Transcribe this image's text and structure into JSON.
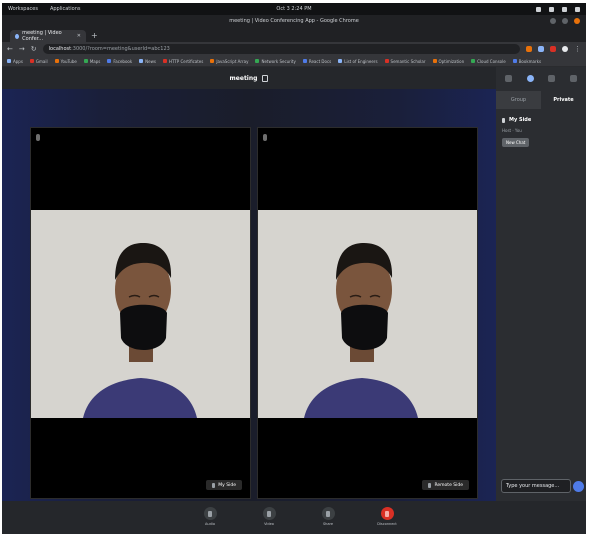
{
  "os_bar": {
    "activities": "Workspaces",
    "applications": "Applications",
    "clock": "Oct 3  2:24 PM",
    "tray_icons": [
      "network-icon",
      "volume-icon",
      "battery-icon",
      "power-icon"
    ]
  },
  "window": {
    "title": "meeting | Video Conferencing App - Google Chrome"
  },
  "browser": {
    "tab_label": "meeting | Video Confer...",
    "address_host": "localhost",
    "address_path": ":3000/?room=meeting&userId=abc123",
    "bookmarks": [
      "Apps",
      "Gmail",
      "YouTube",
      "Maps",
      "Facebook",
      "News",
      "HTTP Certificates",
      "JavaScript Array",
      "Network Security",
      "React Docs",
      "List of Engineers",
      "Semantic Scholar",
      "Optimization",
      "Cloud Console",
      "Bookmarks"
    ]
  },
  "meeting": {
    "room_name": "meeting",
    "participants": [
      {
        "name": "My Side"
      },
      {
        "name": "Remote Side"
      }
    ]
  },
  "sidebar": {
    "tabs": [
      "Group",
      "Private"
    ],
    "active_tab": "Private",
    "participant_name": "My Side",
    "participant_sub": "Host · You",
    "participant_button": "New Chat",
    "chat_placeholder": "Type your message..."
  },
  "toolbar": {
    "buttons": [
      "Audio",
      "Video",
      "Share",
      "Disconnect"
    ]
  },
  "colors": {
    "accent": "#4f7be8",
    "leave": "#d93025",
    "stage_edge": "#1b2454",
    "panel": "#2b2d31"
  }
}
